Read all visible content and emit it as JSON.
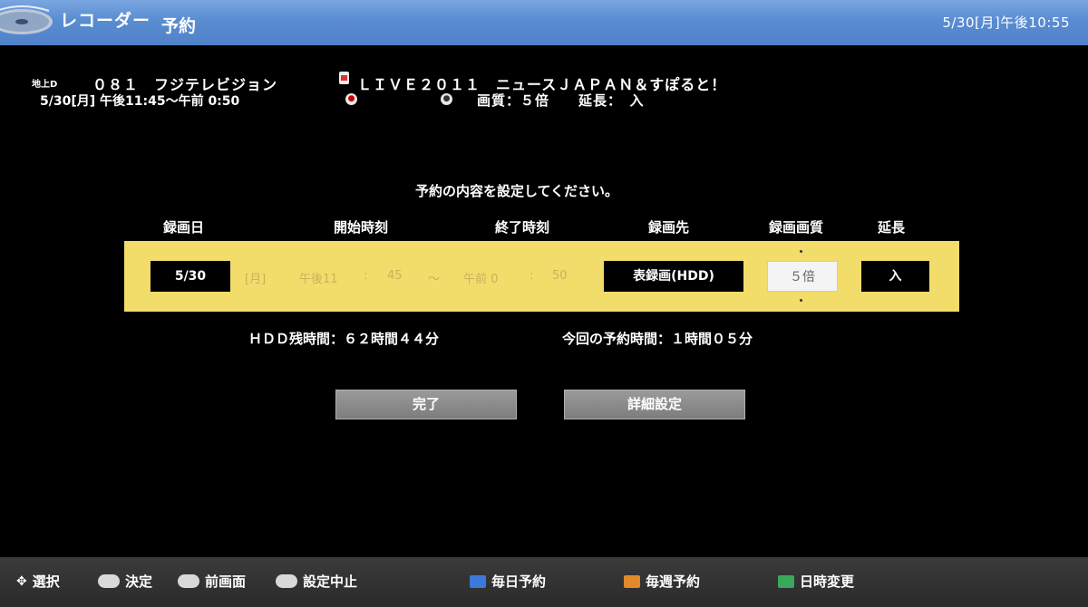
{
  "header": {
    "app_name": "レコーダー",
    "screen_title": "予約",
    "clock": "5/30[月]午後10:55"
  },
  "program": {
    "ch_type": "地上D",
    "channel": "０８１　フジテレビジョン",
    "time_range": "5/30[月] 午後11:45～午前 0:50",
    "title": "ＬＩＶＥ２０１１　ニュースＪＡＰＡＮ＆すぽると！",
    "quality_info": "画質：５倍　　延長：　入"
  },
  "settings": {
    "prompt": "予約の内容を設定してください。",
    "col_date": "録画日",
    "col_start": "開始時刻",
    "col_end": "終了時刻",
    "col_dest": "録画先",
    "col_quality": "録画画質",
    "col_extend": "延長",
    "date": "5/30",
    "weekday": "[月]",
    "start_ampm": "午後11",
    "start_sep": ":",
    "start_min": "45",
    "tilde": "～",
    "end_ampm": "午前 0",
    "end_sep": ":",
    "end_min": "50",
    "dest": "表録画(HDD)",
    "quality": "５倍",
    "extend": "入"
  },
  "status": {
    "hdd_remaining": "ＨＤＤ残時間：６２時間４４分",
    "reservation_duration": "今回の予約時間：１時間０５分"
  },
  "buttons": {
    "complete": "完了",
    "detail": "詳細設定"
  },
  "footer": {
    "select": "選択",
    "decide": "決定",
    "prev_screen": "前画面",
    "cancel_setting": "設定中止",
    "daily": "毎日予約",
    "weekly": "毎週予約",
    "datetime_change": "日時変更",
    "blue_key": "#3a7ad8",
    "orange_key": "#e08a2a",
    "green_key": "#3aa85a"
  }
}
